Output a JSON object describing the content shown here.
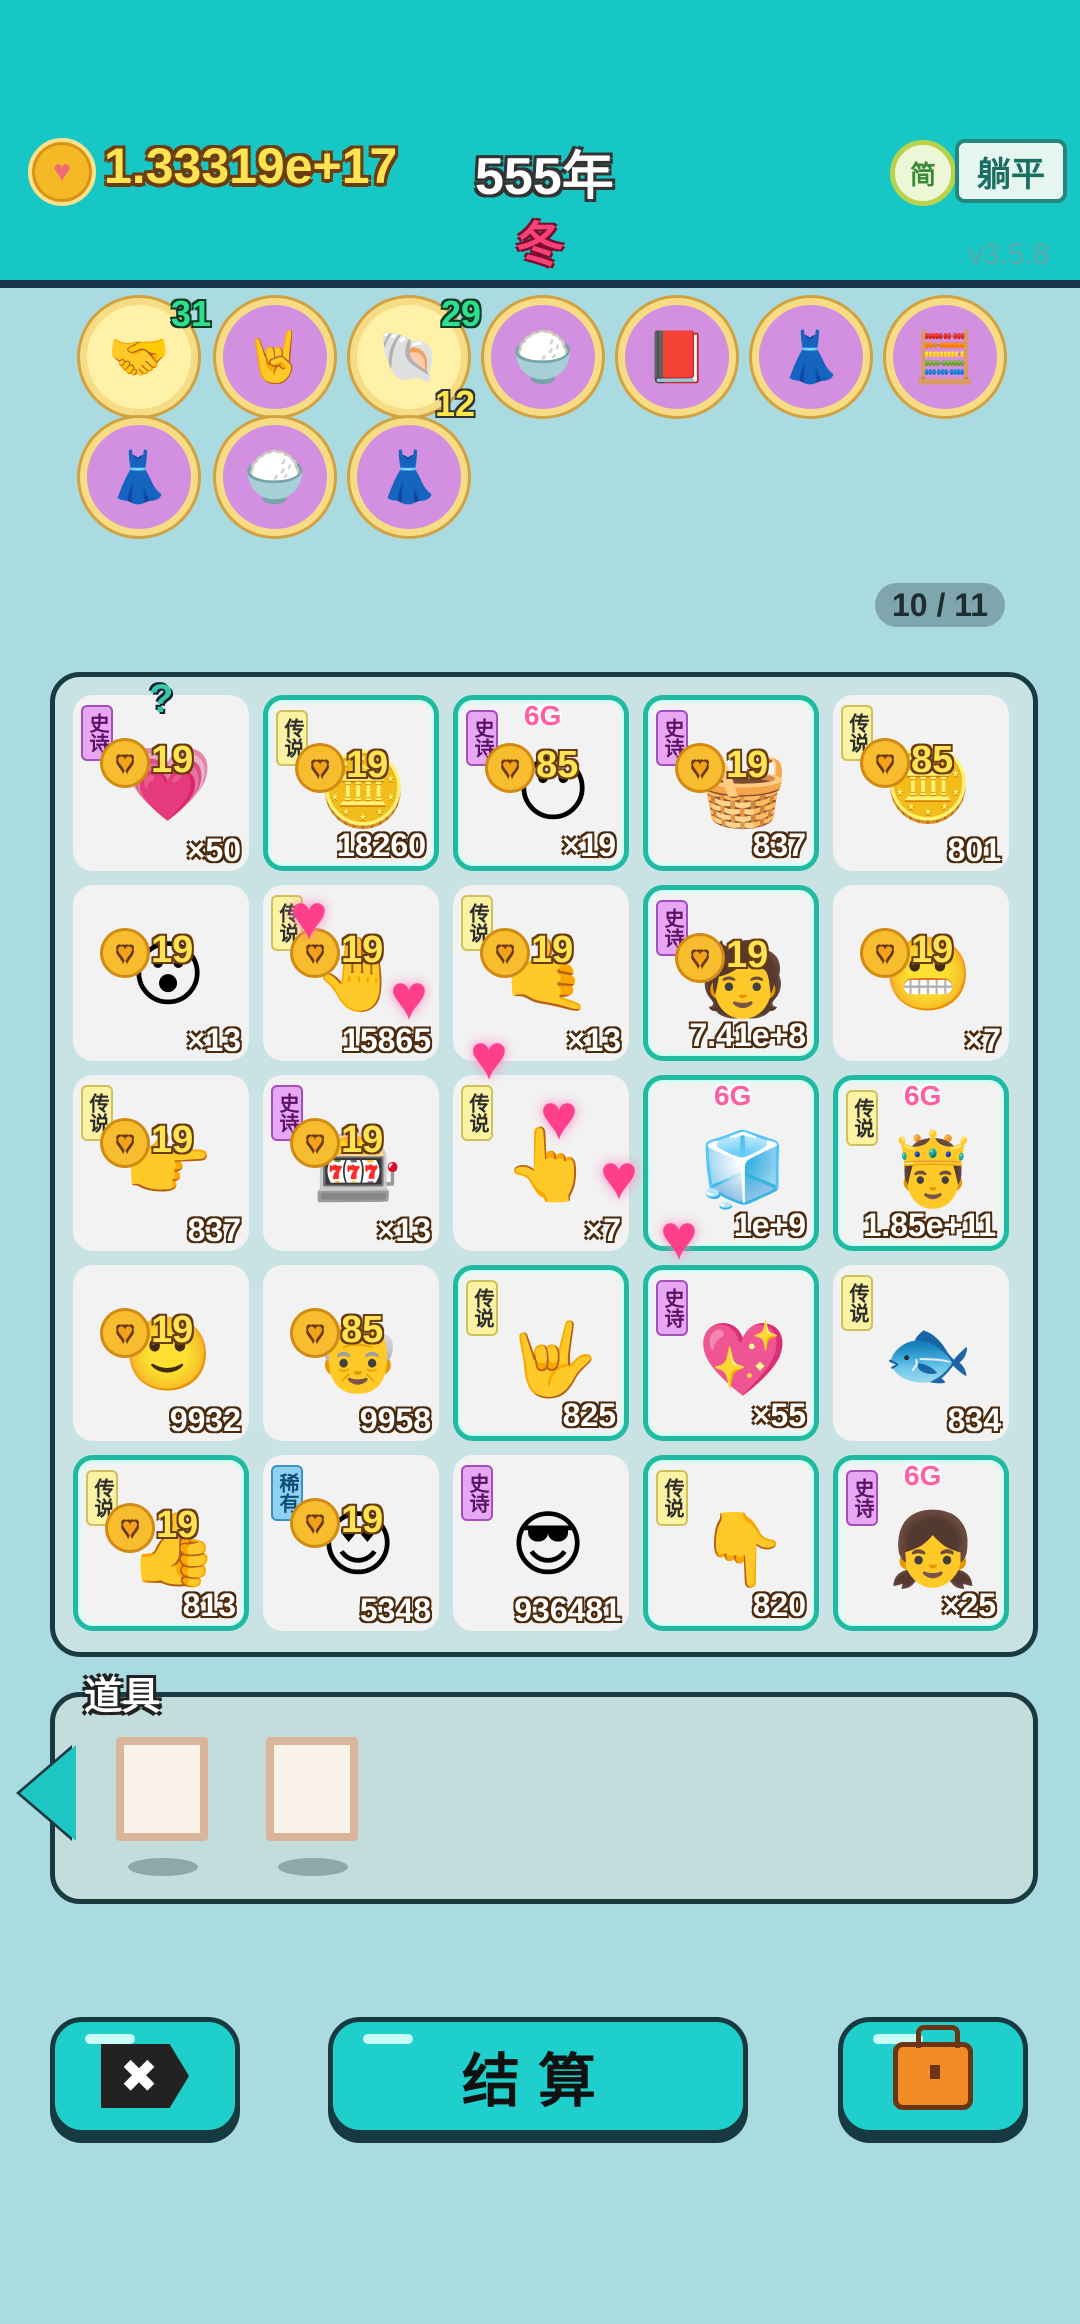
{
  "header": {
    "coin_icon": "heart-coin-icon",
    "money": "1.33319e+17",
    "year": "555年",
    "season": "冬",
    "lang_btn": "简",
    "mode_btn": "躺平",
    "version": "v3.5.8"
  },
  "skills": [
    {
      "icon": "🤝",
      "top_badge": "31",
      "bottom_badge": "",
      "style": "gold"
    },
    {
      "icon": "🤘",
      "top_badge": "",
      "bottom_badge": "",
      "style": "purple"
    },
    {
      "icon": "🐚",
      "top_badge": "29",
      "bottom_badge": "12",
      "style": "gold"
    },
    {
      "icon": "🍚",
      "top_badge": "",
      "bottom_badge": "",
      "style": "purple"
    },
    {
      "icon": "📕",
      "top_badge": "",
      "bottom_badge": "",
      "style": "purple"
    },
    {
      "icon": "👗",
      "top_badge": "",
      "bottom_badge": "",
      "style": "purple"
    },
    {
      "icon": "🧮",
      "top_badge": "",
      "bottom_badge": "",
      "style": "purple"
    },
    {
      "icon": "👗",
      "top_badge": "",
      "bottom_badge": "",
      "style": "purple"
    },
    {
      "icon": "🍚",
      "top_badge": "",
      "bottom_badge": "",
      "style": "purple"
    },
    {
      "icon": "👗",
      "top_badge": "",
      "bottom_badge": "",
      "style": "purple"
    }
  ],
  "pager": "10 / 11",
  "grid": [
    {
      "tag": "史诗",
      "tag_type": "epic",
      "icon": "💗",
      "value": "×50",
      "coins": "19",
      "hl": false,
      "sixg": "",
      "q": "?"
    },
    {
      "tag": "传说",
      "tag_type": "legend",
      "icon": "🪙",
      "value": "18260",
      "coins": "19",
      "hl": true,
      "sixg": "",
      "q": ""
    },
    {
      "tag": "史诗",
      "tag_type": "epic",
      "icon": "😶",
      "value": "×19",
      "coins": "85",
      "hl": true,
      "sixg": "6G",
      "q": ""
    },
    {
      "tag": "史诗",
      "tag_type": "epic",
      "icon": "🧺",
      "value": "837",
      "coins": "19",
      "hl": true,
      "sixg": "",
      "q": ""
    },
    {
      "tag": "传说",
      "tag_type": "legend",
      "icon": "🪙",
      "value": "801",
      "coins": "85",
      "hl": false,
      "sixg": "",
      "q": ""
    },
    {
      "tag": "",
      "tag_type": "",
      "icon": "😮",
      "value": "×13",
      "coins": "19",
      "hl": false,
      "sixg": "",
      "q": ""
    },
    {
      "tag": "传说",
      "tag_type": "legend",
      "icon": "🤚",
      "value": "15865",
      "coins": "19",
      "hl": false,
      "sixg": "",
      "q": ""
    },
    {
      "tag": "传说",
      "tag_type": "legend",
      "icon": "🤙",
      "value": "×13",
      "coins": "19",
      "hl": false,
      "sixg": "",
      "q": ""
    },
    {
      "tag": "史诗",
      "tag_type": "epic",
      "icon": "🧑",
      "value": "7.41e+8",
      "coins": "19",
      "hl": true,
      "sixg": "",
      "q": ""
    },
    {
      "tag": "",
      "tag_type": "",
      "icon": "😬",
      "value": "×7",
      "coins": "19",
      "hl": false,
      "sixg": "",
      "q": ""
    },
    {
      "tag": "传说",
      "tag_type": "legend",
      "icon": "👉",
      "value": "837",
      "coins": "19",
      "hl": false,
      "sixg": "",
      "q": ""
    },
    {
      "tag": "史诗",
      "tag_type": "epic",
      "icon": "🎰",
      "value": "×13",
      "coins": "19",
      "hl": false,
      "sixg": "",
      "q": ""
    },
    {
      "tag": "传说",
      "tag_type": "legend",
      "icon": "👆",
      "value": "×7",
      "coins": "",
      "hl": false,
      "sixg": "",
      "q": ""
    },
    {
      "tag": "",
      "tag_type": "",
      "icon": "🧊",
      "value": "1e+9",
      "coins": "",
      "hl": true,
      "sixg": "6G",
      "q": ""
    },
    {
      "tag": "传说",
      "tag_type": "legend",
      "icon": "🤴",
      "value": "1.85e+11",
      "coins": "",
      "hl": true,
      "sixg": "6G",
      "q": ""
    },
    {
      "tag": "",
      "tag_type": "",
      "icon": "🙂",
      "value": "9932",
      "coins": "19",
      "hl": false,
      "sixg": "",
      "q": ""
    },
    {
      "tag": "",
      "tag_type": "",
      "icon": "👴",
      "value": "9958",
      "coins": "85",
      "hl": false,
      "sixg": "",
      "q": ""
    },
    {
      "tag": "传说",
      "tag_type": "legend",
      "icon": "🤟",
      "value": "825",
      "coins": "",
      "hl": true,
      "sixg": "",
      "q": ""
    },
    {
      "tag": "史诗",
      "tag_type": "epic",
      "icon": "💖",
      "value": "×55",
      "coins": "",
      "hl": true,
      "sixg": "",
      "q": ""
    },
    {
      "tag": "传说",
      "tag_type": "legend",
      "icon": "🐟",
      "value": "834",
      "coins": "",
      "hl": false,
      "sixg": "",
      "q": ""
    },
    {
      "tag": "传说",
      "tag_type": "legend",
      "icon": "👍",
      "value": "813",
      "coins": "19",
      "hl": true,
      "sixg": "",
      "q": ""
    },
    {
      "tag": "稀有",
      "tag_type": "rare",
      "icon": "😍",
      "value": "5348",
      "coins": "19",
      "hl": false,
      "sixg": "",
      "q": ""
    },
    {
      "tag": "史诗",
      "tag_type": "epic",
      "icon": "😎",
      "value": "936481",
      "coins": "",
      "hl": false,
      "sixg": "",
      "q": ""
    },
    {
      "tag": "传说",
      "tag_type": "legend",
      "icon": "👇",
      "value": "820",
      "coins": "",
      "hl": true,
      "sixg": "",
      "q": ""
    },
    {
      "tag": "史诗",
      "tag_type": "epic",
      "icon": "👧",
      "value": "×25",
      "coins": "",
      "hl": true,
      "sixg": "6G",
      "q": ""
    }
  ],
  "items": {
    "title": "道具",
    "slots": [
      "frame",
      "frame"
    ]
  },
  "buttons": {
    "close_icon": "✖",
    "settle": "结算",
    "bag_icon": "briefcase-icon"
  }
}
